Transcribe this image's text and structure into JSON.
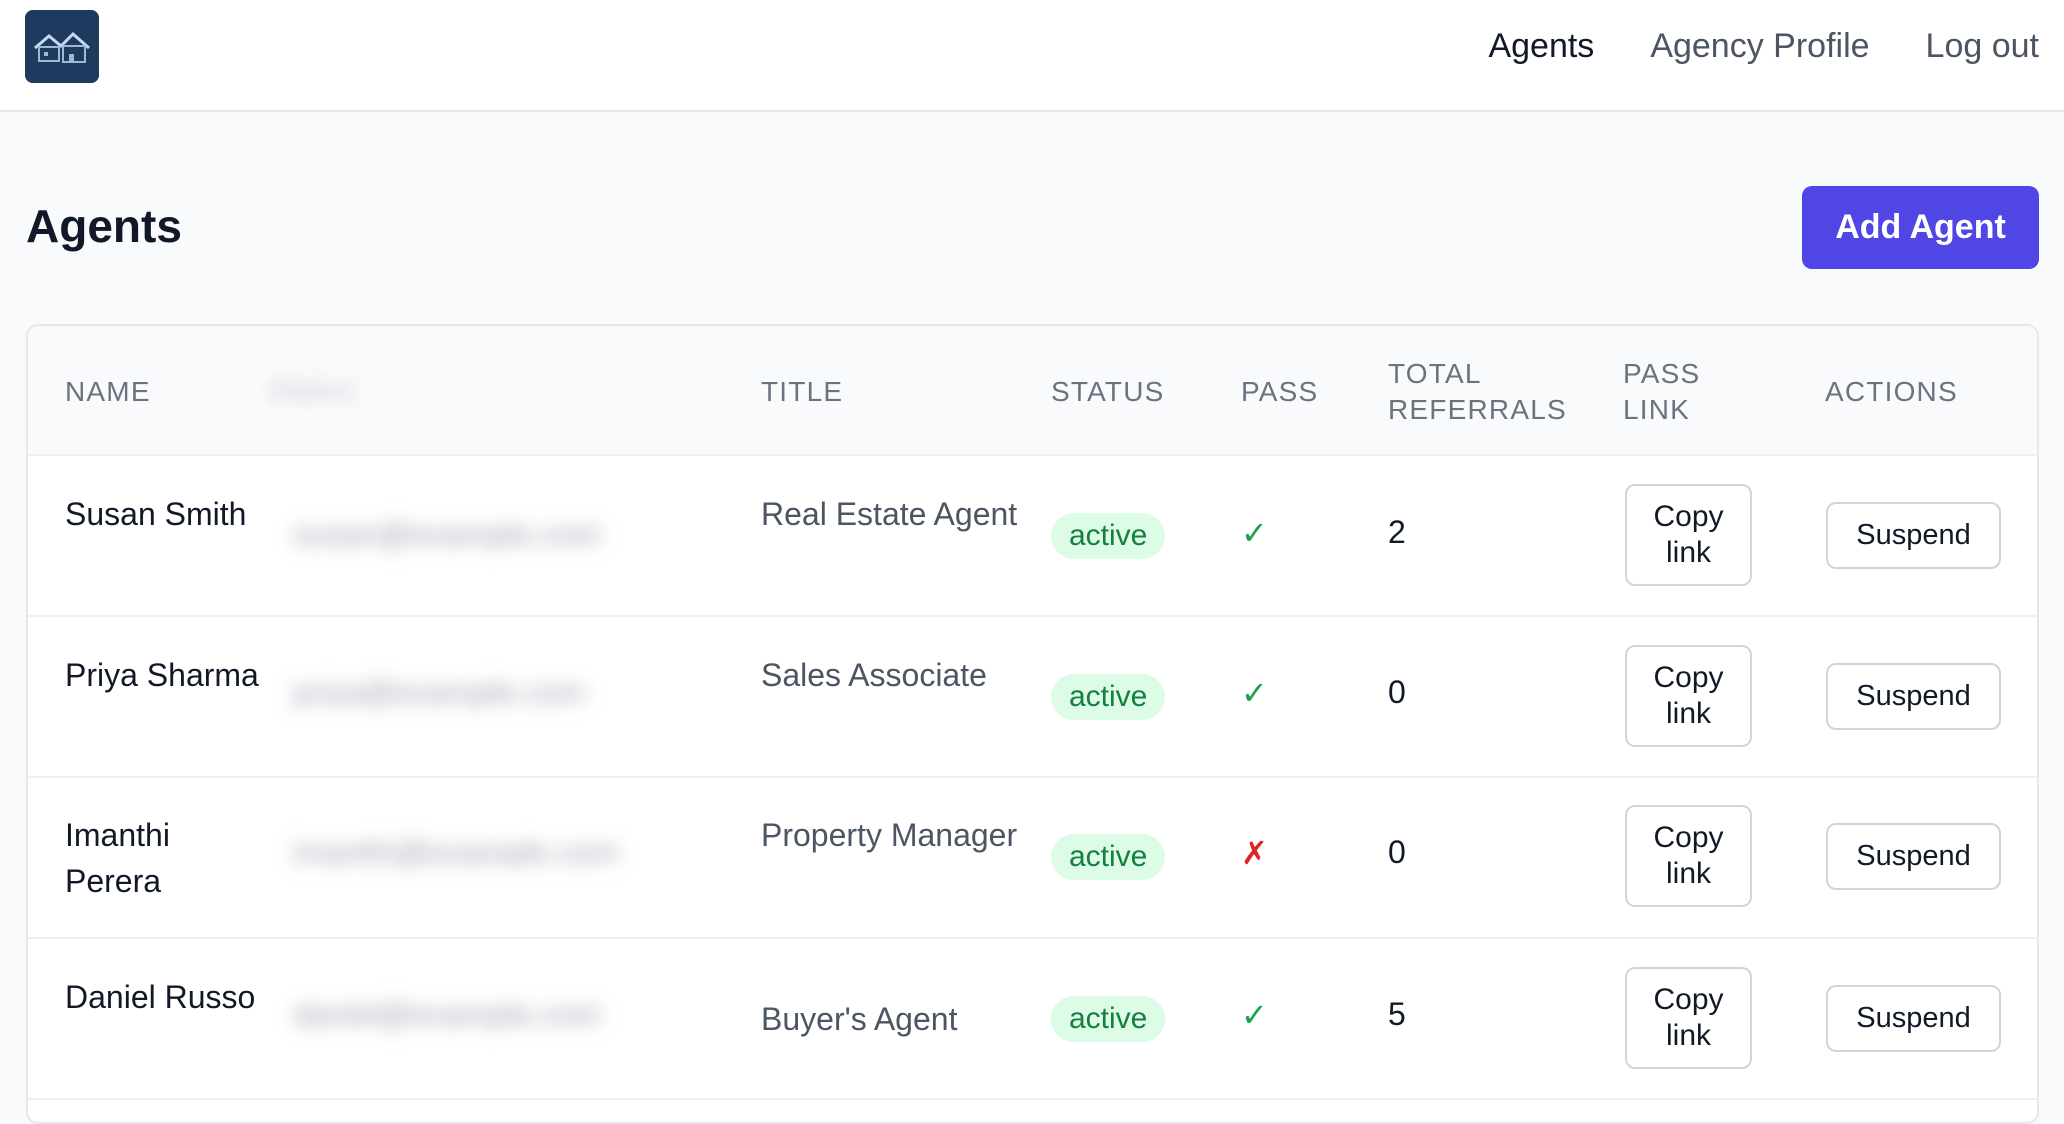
{
  "nav": {
    "items": [
      {
        "label": "Agents",
        "active": true
      },
      {
        "label": "Agency Profile",
        "active": false
      },
      {
        "label": "Log out",
        "active": false
      }
    ]
  },
  "page": {
    "title": "Agents",
    "add_button": "Add Agent"
  },
  "table": {
    "headers": {
      "name": "NAME",
      "email": "EMAIL",
      "title": "TITLE",
      "status": "STATUS",
      "pass": "PASS",
      "total_referrals": "TOTAL REFERRALS",
      "pass_link": "PASS LINK",
      "actions": "ACTIONS"
    },
    "rows": [
      {
        "name": "Susan Smith",
        "email": "susan@example.com",
        "title": "Real Estate Agent",
        "status": "active",
        "pass": "✓",
        "referrals": "2",
        "copy_label": "Copy link",
        "action_label": "Suspend"
      },
      {
        "name": "Priya Sharma",
        "email": "priya@example.com",
        "title": "Sales Associate",
        "status": "active",
        "pass": "✓",
        "referrals": "0",
        "copy_label": "Copy link",
        "action_label": "Suspend"
      },
      {
        "name": "Imanthi Perera",
        "email": "imanthi@example.com",
        "title": "Property Manager",
        "status": "active",
        "pass": "✗",
        "referrals": "0",
        "copy_label": "Copy link",
        "action_label": "Suspend"
      },
      {
        "name": "Daniel Russo",
        "email": "daniel@example.com",
        "title": "Buyer's Agent",
        "status": "active",
        "pass": "✓",
        "referrals": "5",
        "copy_label": "Copy link",
        "action_label": "Suspend"
      }
    ]
  },
  "colors": {
    "primary": "#4f46e5",
    "badge_bg": "#dcfce7",
    "badge_text": "#15803d",
    "check": "#16a34a",
    "cross": "#dc2626"
  },
  "icons": {
    "logo": "house-logo-icon",
    "pass_ok": "check-icon",
    "pass_no": "cross-icon"
  }
}
